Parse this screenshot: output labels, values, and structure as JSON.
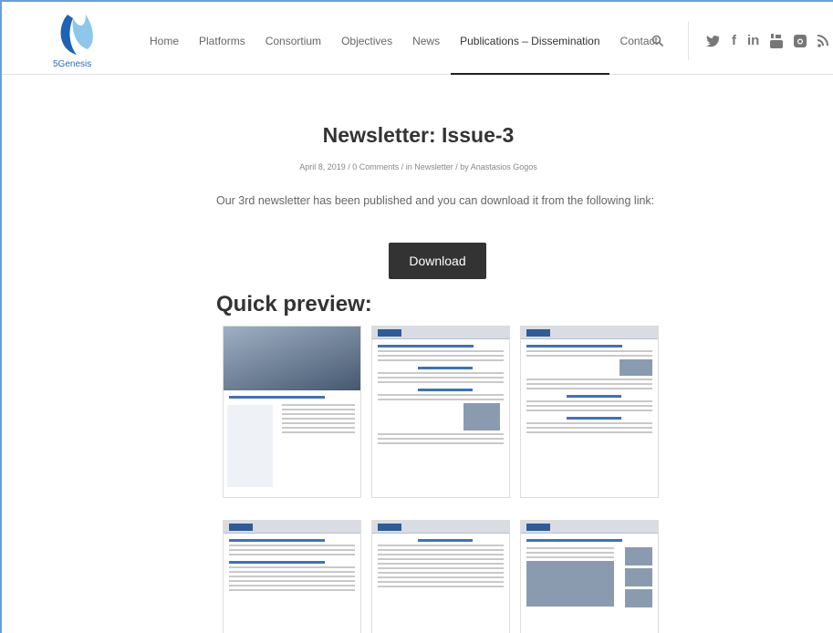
{
  "brand": {
    "name": "5Genesis"
  },
  "nav": {
    "items": [
      "Home",
      "Platforms",
      "Consortium",
      "Objectives",
      "News",
      "Publications – Dissemination",
      "Contact"
    ],
    "active": "Publications – Dissemination"
  },
  "social": {
    "icons": [
      "twitter-icon",
      "facebook-icon",
      "linkedin-icon",
      "youtube-icon",
      "instagram-icon",
      "rss-icon"
    ],
    "glyphs": [
      "",
      "f",
      "in",
      "",
      "",
      ""
    ]
  },
  "post": {
    "title": "Newsletter: Issue-3",
    "meta": "April 8, 2019 / 0 Comments / in Newsletter  / by Anastasios Gogos",
    "body": "Our 3rd newsletter has been published and  you can download it from the following link:",
    "download_label": "Download",
    "preview_heading": "Quick preview:"
  },
  "colors": {
    "accent": "#222222",
    "brand_blue": "#2a6db5"
  }
}
